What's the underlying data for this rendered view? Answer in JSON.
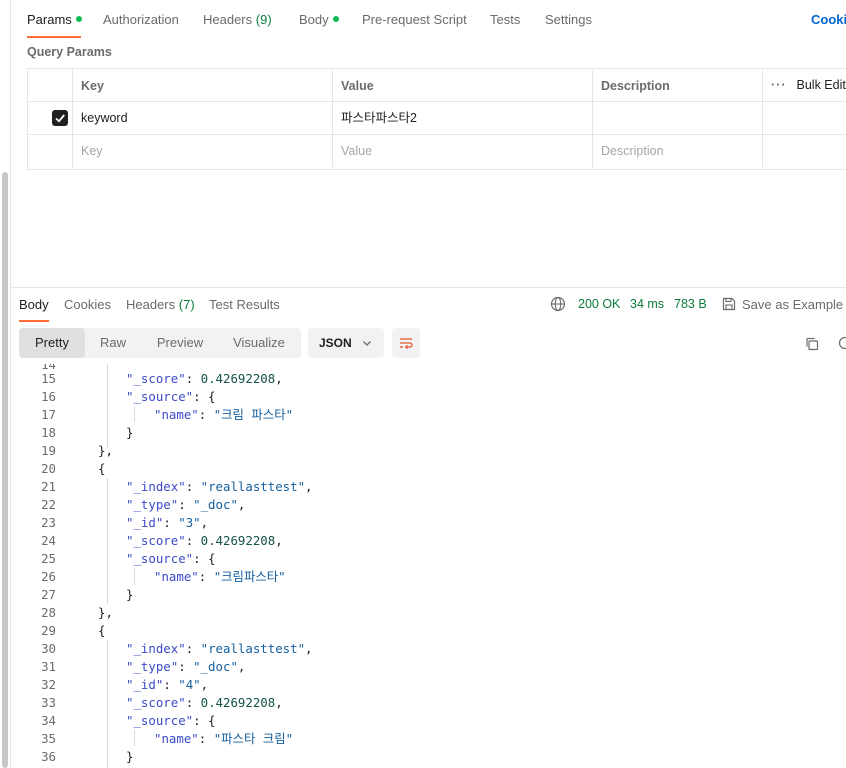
{
  "request_tabs": [
    {
      "label": "Params",
      "dot": true,
      "active": true
    },
    {
      "label": "Authorization"
    },
    {
      "label": "Headers",
      "count": "(9)"
    },
    {
      "label": "Body",
      "dot": true
    },
    {
      "label": "Pre-request Script"
    },
    {
      "label": "Tests"
    },
    {
      "label": "Settings"
    }
  ],
  "cookies_link": "Cookies",
  "query_params": {
    "title": "Query Params",
    "headers": {
      "key": "Key",
      "value": "Value",
      "description": "Description",
      "bulk_edit": "Bulk Edit"
    },
    "rows": [
      {
        "checked": true,
        "key": "keyword",
        "value": "파스타파스타2",
        "description": ""
      }
    ],
    "placeholder": {
      "key": "Key",
      "value": "Value",
      "description": "Description"
    }
  },
  "response": {
    "tabs": [
      {
        "label": "Body",
        "active": true
      },
      {
        "label": "Cookies"
      },
      {
        "label": "Headers",
        "count": "(7)"
      },
      {
        "label": "Test Results"
      }
    ],
    "status": "200 OK",
    "time": "34 ms",
    "size": "783 B",
    "save_example": "Save as Example",
    "view_modes": [
      "Pretty",
      "Raw",
      "Preview",
      "Visualize"
    ],
    "active_view": "Pretty",
    "format": "JSON"
  },
  "colors": {
    "accent": "#ff6c37",
    "success": "#0a7e3b",
    "link": "#0265d2",
    "dot": "#0cbb52"
  },
  "code_lines": [
    {
      "n": "15",
      "indent": 2,
      "tokens": [
        [
          "k",
          "\"_score\""
        ],
        [
          "p",
          ": "
        ],
        [
          "n",
          "0.42692208"
        ],
        [
          "p",
          ","
        ]
      ]
    },
    {
      "n": "16",
      "indent": 2,
      "tokens": [
        [
          "k",
          "\"_source\""
        ],
        [
          "p",
          ": {"
        ]
      ]
    },
    {
      "n": "17",
      "indent": 3,
      "tokens": [
        [
          "k",
          "\"name\""
        ],
        [
          "p",
          ": "
        ],
        [
          "s",
          "\"크림 파스타\""
        ]
      ]
    },
    {
      "n": "18",
      "indent": 2,
      "tokens": [
        [
          "p",
          "}"
        ]
      ]
    },
    {
      "n": "19",
      "indent": 1,
      "tokens": [
        [
          "p",
          "},"
        ]
      ]
    },
    {
      "n": "20",
      "indent": 1,
      "tokens": [
        [
          "p",
          "{"
        ]
      ]
    },
    {
      "n": "21",
      "indent": 2,
      "tokens": [
        [
          "k",
          "\"_index\""
        ],
        [
          "p",
          ": "
        ],
        [
          "s",
          "\"reallasttest\""
        ],
        [
          "p",
          ","
        ]
      ]
    },
    {
      "n": "22",
      "indent": 2,
      "tokens": [
        [
          "k",
          "\"_type\""
        ],
        [
          "p",
          ": "
        ],
        [
          "s",
          "\"_doc\""
        ],
        [
          "p",
          ","
        ]
      ]
    },
    {
      "n": "23",
      "indent": 2,
      "tokens": [
        [
          "k",
          "\"_id\""
        ],
        [
          "p",
          ": "
        ],
        [
          "s",
          "\"3\""
        ],
        [
          "p",
          ","
        ]
      ]
    },
    {
      "n": "24",
      "indent": 2,
      "tokens": [
        [
          "k",
          "\"_score\""
        ],
        [
          "p",
          ": "
        ],
        [
          "n",
          "0.42692208"
        ],
        [
          "p",
          ","
        ]
      ]
    },
    {
      "n": "25",
      "indent": 2,
      "tokens": [
        [
          "k",
          "\"_source\""
        ],
        [
          "p",
          ": {"
        ]
      ]
    },
    {
      "n": "26",
      "indent": 3,
      "tokens": [
        [
          "k",
          "\"name\""
        ],
        [
          "p",
          ": "
        ],
        [
          "s",
          "\"크림파스타\""
        ]
      ]
    },
    {
      "n": "27",
      "indent": 2,
      "tokens": [
        [
          "p",
          "}"
        ]
      ]
    },
    {
      "n": "28",
      "indent": 1,
      "tokens": [
        [
          "p",
          "},"
        ]
      ]
    },
    {
      "n": "29",
      "indent": 1,
      "tokens": [
        [
          "p",
          "{"
        ]
      ]
    },
    {
      "n": "30",
      "indent": 2,
      "tokens": [
        [
          "k",
          "\"_index\""
        ],
        [
          "p",
          ": "
        ],
        [
          "s",
          "\"reallasttest\""
        ],
        [
          "p",
          ","
        ]
      ]
    },
    {
      "n": "31",
      "indent": 2,
      "tokens": [
        [
          "k",
          "\"_type\""
        ],
        [
          "p",
          ": "
        ],
        [
          "s",
          "\"_doc\""
        ],
        [
          "p",
          ","
        ]
      ]
    },
    {
      "n": "32",
      "indent": 2,
      "tokens": [
        [
          "k",
          "\"_id\""
        ],
        [
          "p",
          ": "
        ],
        [
          "s",
          "\"4\""
        ],
        [
          "p",
          ","
        ]
      ]
    },
    {
      "n": "33",
      "indent": 2,
      "tokens": [
        [
          "k",
          "\"_score\""
        ],
        [
          "p",
          ": "
        ],
        [
          "n",
          "0.42692208"
        ],
        [
          "p",
          ","
        ]
      ]
    },
    {
      "n": "34",
      "indent": 2,
      "tokens": [
        [
          "k",
          "\"_source\""
        ],
        [
          "p",
          ": {"
        ]
      ]
    },
    {
      "n": "35",
      "indent": 3,
      "tokens": [
        [
          "k",
          "\"name\""
        ],
        [
          "p",
          ": "
        ],
        [
          "s",
          "\"파스타 크림\""
        ]
      ]
    },
    {
      "n": "36",
      "indent": 2,
      "tokens": [
        [
          "p",
          "}"
        ]
      ]
    }
  ]
}
